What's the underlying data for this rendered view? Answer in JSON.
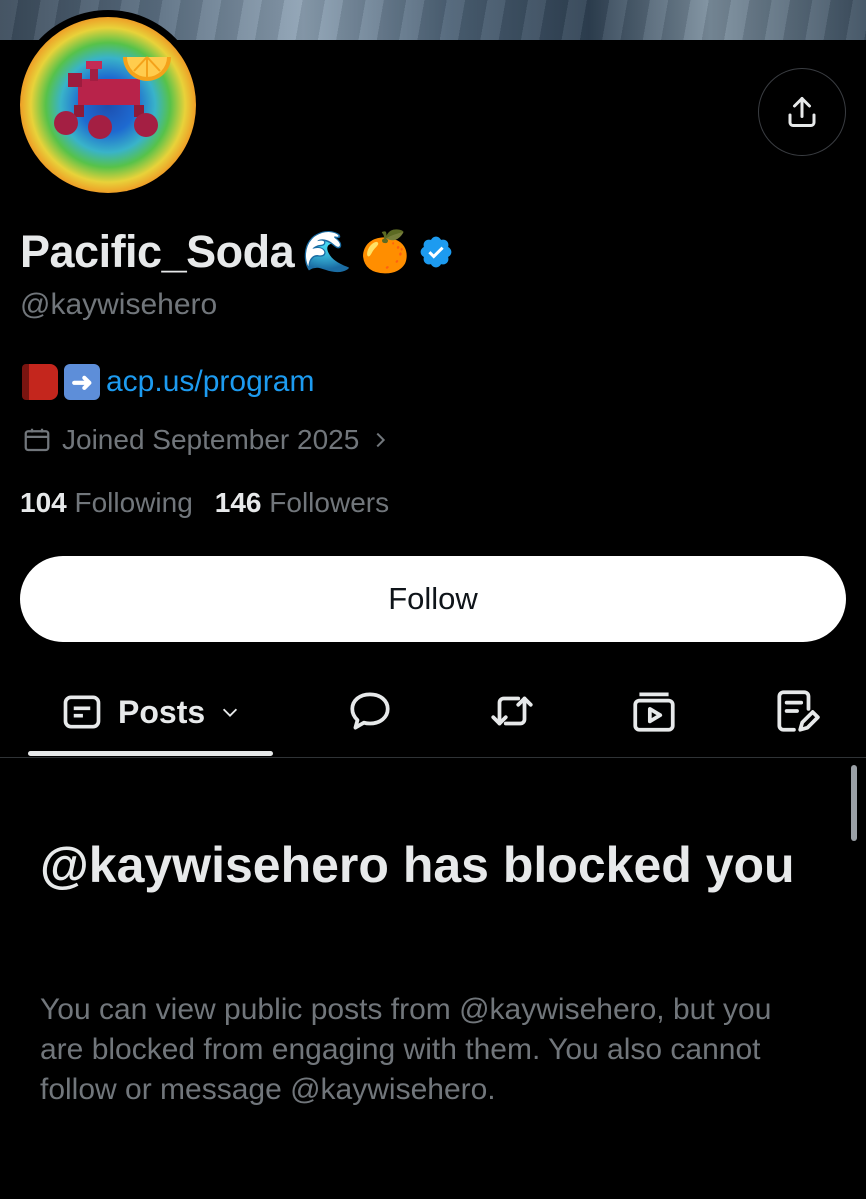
{
  "profile": {
    "display_name": "Pacific_Soda",
    "name_emojis": [
      "🌊",
      "🍊"
    ],
    "handle": "@kaywisehero",
    "verified": true,
    "bio_link": "acp.us/program",
    "joined": "Joined September 2025",
    "following_count": "104",
    "following_label": "Following",
    "followers_count": "146",
    "followers_label": "Followers"
  },
  "actions": {
    "follow_label": "Follow",
    "share_icon": "share-icon"
  },
  "tabs": {
    "active_label": "Posts",
    "icons": [
      "posts-icon",
      "replies-icon",
      "reposts-icon",
      "media-icon",
      "articles-icon"
    ]
  },
  "notice": {
    "title": "@kaywisehero has blocked you",
    "body": "You can view public posts from @kaywisehero, but you are blocked from engaging with them. You also cannot follow or message @kaywisehero."
  },
  "colors": {
    "background": "#000000",
    "text_primary": "#e7e9ea",
    "text_secondary": "#71767b",
    "link": "#1d9bf0",
    "verified": "#1d9bf0"
  }
}
